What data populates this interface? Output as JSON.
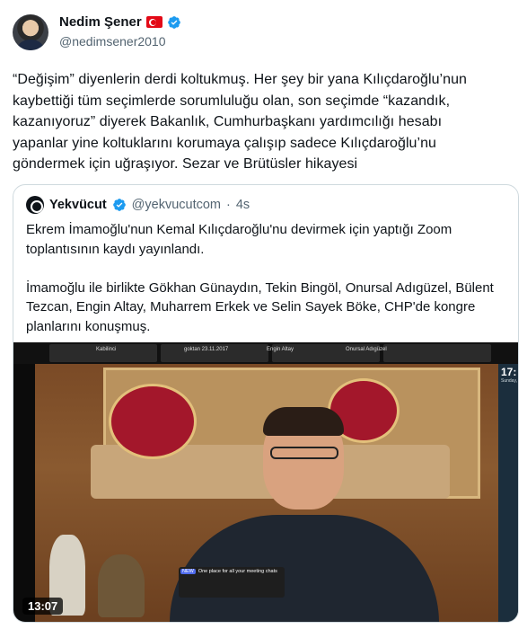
{
  "author": {
    "name": "Nedim Şener",
    "handle": "@nedimsener2010",
    "flag_icon": "turkey-flag-icon",
    "verified_icon": "verified-badge-icon",
    "verified_color": "#1d9bf0"
  },
  "tweet": {
    "lines": [
      "“Değişim” diyenlerin derdi koltukmuş. Her şey bir yana Kılıçdaroğlu’nun",
      "kaybettiği tüm seçimlerde sorumluluğu olan, son seçimde “kazandık,",
      "kazanıyoruz” diyerek Bakanlık, Cumhurbaşkanı yardımcılığı hesabı",
      "yapanlar yine koltuklarını korumaya çalışıp sadece Kılıçdaroğlu’nu",
      "göndermek için uğraşıyor.  Sezar ve Brütüsler hikayesi"
    ]
  },
  "quoted": {
    "name": "Yekvücut",
    "handle": "@yekvucutcom",
    "separator": "·",
    "time": "4s",
    "verified_icon": "verified-badge-icon",
    "paragraph1": [
      "Ekrem İmamoğlu'nun Kemal Kılıçdaroğlu'nu devirmek için yaptığı Zoom",
      "toplantısının kaydı yayınlandı."
    ],
    "paragraph2": [
      "İmamoğlu ile birlikte Gökhan Günaydın, Tekin Bingöl, Onursal Adıgüzel, Bülent",
      "Tezcan, Engin Altay, Muharrem Erkek ve Selin Sayek Böke, CHP'de kongre",
      "planlarını konuşmuş."
    ],
    "video": {
      "duration": "13:07",
      "participants": [
        "Kabilinci",
        "goktan 23.11.2017",
        "Engin Altay",
        "Onursal Adıgüzel"
      ],
      "clock": "17:",
      "clock_sub": "Sunday,",
      "notification_tag": "NEW",
      "notification_title": "One place for all your meeting chats"
    }
  }
}
